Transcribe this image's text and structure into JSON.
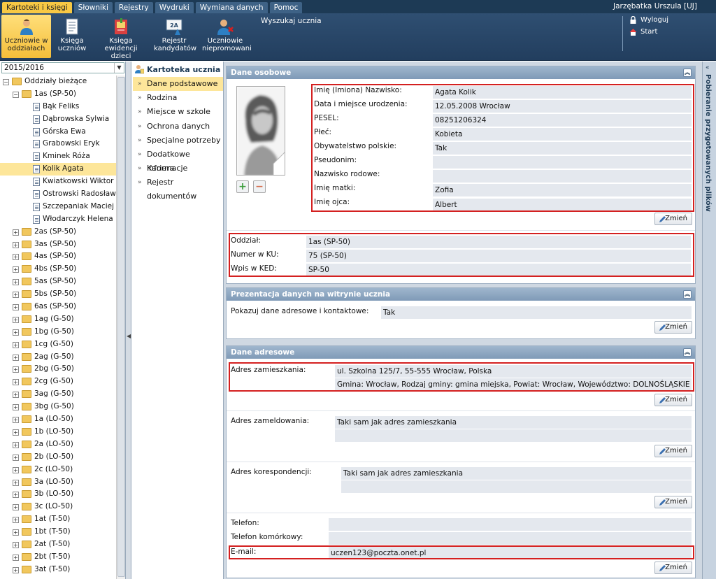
{
  "menu": {
    "tabs": [
      "Kartoteki i księgi",
      "Słowniki",
      "Rejestry",
      "Wydruki",
      "Wymiana danych",
      "Pomoc"
    ],
    "user": "Jarzębatka Urszula [UJ]"
  },
  "toolbar": {
    "buttons": [
      {
        "line1": "Uczniowie w",
        "line2": "oddziałach"
      },
      {
        "line1": "Księga",
        "line2": "uczniów"
      },
      {
        "line1": "Księga",
        "line2": "ewidencji dzieci"
      },
      {
        "line1": "Rejestr",
        "line2": "kandydatów"
      },
      {
        "line1": "Uczniowie",
        "line2": "niepromowani"
      }
    ],
    "icon_badge": "2A",
    "search": "Wyszukaj ucznia",
    "logout": "Wyloguj",
    "start": "Start"
  },
  "left": {
    "year": "2015/2016",
    "root": "Oddziały bieżące",
    "open_class": "1as (SP-50)",
    "students": [
      "Bąk Feliks",
      "Dąbrowska Sylwia",
      "Górska Ewa",
      "Grabowski Eryk",
      "Kminek Róża",
      "Kolik Agata",
      "Kwiatkowski Wiktor",
      "Ostrowski Radosław",
      "Szczepaniak Maciej",
      "Włodarczyk Helena"
    ],
    "classes": [
      "2as (SP-50)",
      "3as (SP-50)",
      "4as (SP-50)",
      "4bs (SP-50)",
      "5as (SP-50)",
      "5bs (SP-50)",
      "6as (SP-50)",
      "1ag (G-50)",
      "1bg (G-50)",
      "1cg (G-50)",
      "2ag (G-50)",
      "2bg (G-50)",
      "2cg (G-50)",
      "3ag (G-50)",
      "3bg (G-50)",
      "1a (LO-50)",
      "1b (LO-50)",
      "2a (LO-50)",
      "2b (LO-50)",
      "2c (LO-50)",
      "3a (LO-50)",
      "3b (LO-50)",
      "3c (LO-50)",
      "1at (T-50)",
      "1bt (T-50)",
      "2at (T-50)",
      "2bt (T-50)",
      "3at (T-50)"
    ]
  },
  "nav": {
    "title": "Kartoteka ucznia",
    "items": [
      "Dane podstawowe",
      "Rodzina",
      "Miejsce w szkole",
      "Ochrona danych",
      "Specjalne potrzeby",
      "Dodatkowe informacje",
      "Kariera",
      "Rejestr dokumentów"
    ]
  },
  "right_strip": "Pobieranie przygotowanych plików",
  "personal": {
    "title": "Dane osobowe",
    "rows": [
      {
        "label": "Imię (Imiona) Nazwisko:",
        "value": "Agata Kolik"
      },
      {
        "label": "Data i miejsce urodzenia:",
        "value": "12.05.2008 Wrocław"
      },
      {
        "label": "PESEL:",
        "value": "08251206324"
      },
      {
        "label": "Płeć:",
        "value": "Kobieta"
      },
      {
        "label": "Obywatelstwo polskie:",
        "value": "Tak"
      },
      {
        "label": "Pseudonim:",
        "value": ""
      },
      {
        "label": "Nazwisko rodowe:",
        "value": ""
      },
      {
        "label": "Imię matki:",
        "value": "Zofia"
      },
      {
        "label": "Imię ojca:",
        "value": "Albert"
      }
    ],
    "class_rows": [
      {
        "label": "Oddział:",
        "value": "1as (SP-50)"
      },
      {
        "label": "Numer w KU:",
        "value": "75 (SP-50)"
      },
      {
        "label": "Wpis w KED:",
        "value": "SP-50"
      }
    ]
  },
  "presentation": {
    "title": "Prezentacja danych na witrynie ucznia",
    "label": "Pokazuj dane adresowe i kontaktowe:",
    "value": "Tak"
  },
  "address": {
    "title": "Dane adresowe",
    "residence_label": "Adres zamieszkania:",
    "residence_line1": "ul. Szkolna 125/7, 55-555 Wrocław, Polska",
    "residence_line2": "Gmina: Wrocław, Rodzaj gminy: gmina miejska, Powiat: Wrocław, Województwo: DOLNOŚLĄSKIE",
    "registered_label": "Adres zameldowania:",
    "registered_value": "Taki sam jak adres zamieszkania",
    "correspondence_label": "Adres korespondencji:",
    "correspondence_value": "Taki sam jak adres zamieszkania",
    "phone_label": "Telefon:",
    "phone_value": "",
    "mobile_label": "Telefon komórkowy:",
    "mobile_value": "",
    "email_label": "E-mail:",
    "email_value": "uczen123@poczta.onet.pl"
  },
  "buttons": {
    "change": "Zmień"
  },
  "colors": {
    "accent": "#f7c844",
    "header": "#1d3a55",
    "highlight": "#d42020"
  }
}
